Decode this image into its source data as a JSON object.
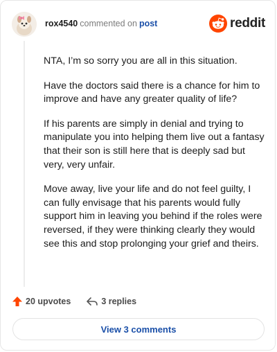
{
  "header": {
    "username": "rox4540",
    "action": "commented on",
    "link": "post",
    "brand": "reddit"
  },
  "comment": {
    "paragraphs": [
      "NTA, I’m so sorry you are all in this situation.",
      "Have the doctors said there is a chance for him to improve and have any greater quality of life?",
      "If his parents are simply in denial and trying to manipulate you into helping them live out a fantasy that their son is still here that is deeply sad but very, very unfair.",
      "Move away, live your life and do not feel guilty, I can fully envisage that his parents would fully support him in leaving you behind if the roles were reversed, if they were thinking clearly they would see this and stop prolonging your grief and theirs."
    ]
  },
  "footer": {
    "upvotes": "20 upvotes",
    "replies": "3 replies",
    "view_comments": "View 3 comments"
  },
  "colors": {
    "upvote": "#ff4500",
    "link": "#1a4fa8",
    "reddit_orange": "#ff4500"
  },
  "icons": {
    "avatar": "avatar",
    "reddit_logo": "reddit-snoo-icon",
    "upvote": "upvote-arrow-icon",
    "reply": "reply-arrow-icon"
  }
}
